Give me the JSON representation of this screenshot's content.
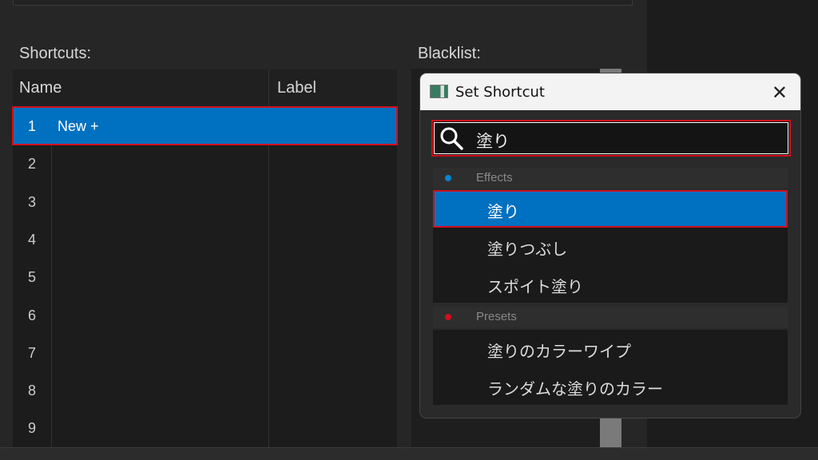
{
  "shortcuts": {
    "label": "Shortcuts:",
    "columns": [
      "Name",
      "Label"
    ],
    "rows": [
      {
        "n": "1",
        "name": "New +"
      },
      {
        "n": "2",
        "name": ""
      },
      {
        "n": "3",
        "name": ""
      },
      {
        "n": "4",
        "name": ""
      },
      {
        "n": "5",
        "name": ""
      },
      {
        "n": "6",
        "name": ""
      },
      {
        "n": "7",
        "name": ""
      },
      {
        "n": "8",
        "name": ""
      },
      {
        "n": "9",
        "name": ""
      }
    ]
  },
  "blacklist": {
    "label": "Blacklist:"
  },
  "dialog": {
    "title": "Set Shortcut",
    "search_value": "塗り",
    "groups": [
      {
        "name": "Effects",
        "color": "#0a84d0",
        "items": [
          "塗り",
          "塗りつぶし",
          "スポイト塗り"
        ]
      },
      {
        "name": "Presets",
        "color": "#d0101c",
        "items": [
          "塗りのカラーワイプ",
          "ランダムな塗りのカラー"
        ]
      }
    ]
  },
  "colors": {
    "accent": "#0070c0",
    "highlight": "#d0101c"
  }
}
